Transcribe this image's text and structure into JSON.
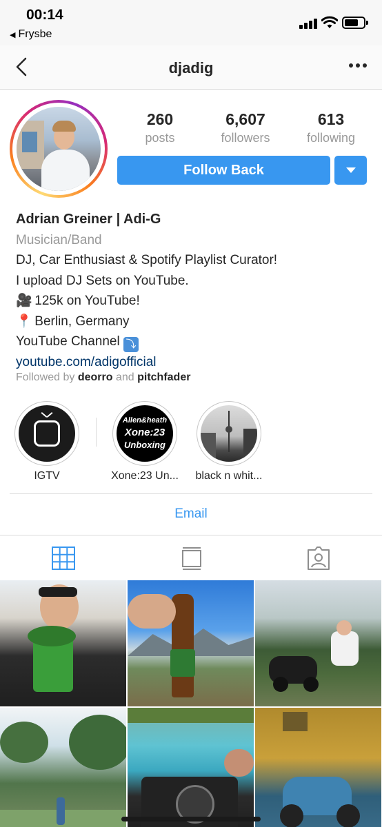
{
  "status_bar": {
    "time": "00:14",
    "back_app": "Frysbe"
  },
  "nav": {
    "username": "djadig"
  },
  "profile": {
    "stats": [
      {
        "value": "260",
        "label": "posts"
      },
      {
        "value": "6,607",
        "label": "followers"
      },
      {
        "value": "613",
        "label": "following"
      }
    ],
    "follow_label": "Follow Back",
    "name": "Adrian Greiner | Adi-G",
    "category": "Musician/Band",
    "bio_lines": [
      "DJ, Car Enthusiast & Spotify Playlist Curator!",
      "I upload DJ Sets on YouTube.",
      "125k on YouTube!",
      "Berlin, Germany",
      "YouTube Channel"
    ],
    "emojis": {
      "camera": "🎥",
      "pin": "📍",
      "arrow": "⤵"
    },
    "website": "youtube.com/adigofficial",
    "followed_by": {
      "prefix": "Followed by",
      "user1": "deorro",
      "conj": "and",
      "user2": "pitchfader"
    }
  },
  "highlights": [
    {
      "label": "IGTV"
    },
    {
      "label": "Xone:23 Un...",
      "cover_lines": [
        "Allen&heath",
        "Xone:23",
        "Unboxing"
      ]
    },
    {
      "label": "black n whit..."
    }
  ],
  "contact": {
    "email_label": "Email"
  },
  "tabs": [
    "grid-icon",
    "feed-icon",
    "tagged-icon"
  ],
  "colors": {
    "accent": "#3897f0",
    "link": "#003569",
    "muted": "#999999"
  }
}
